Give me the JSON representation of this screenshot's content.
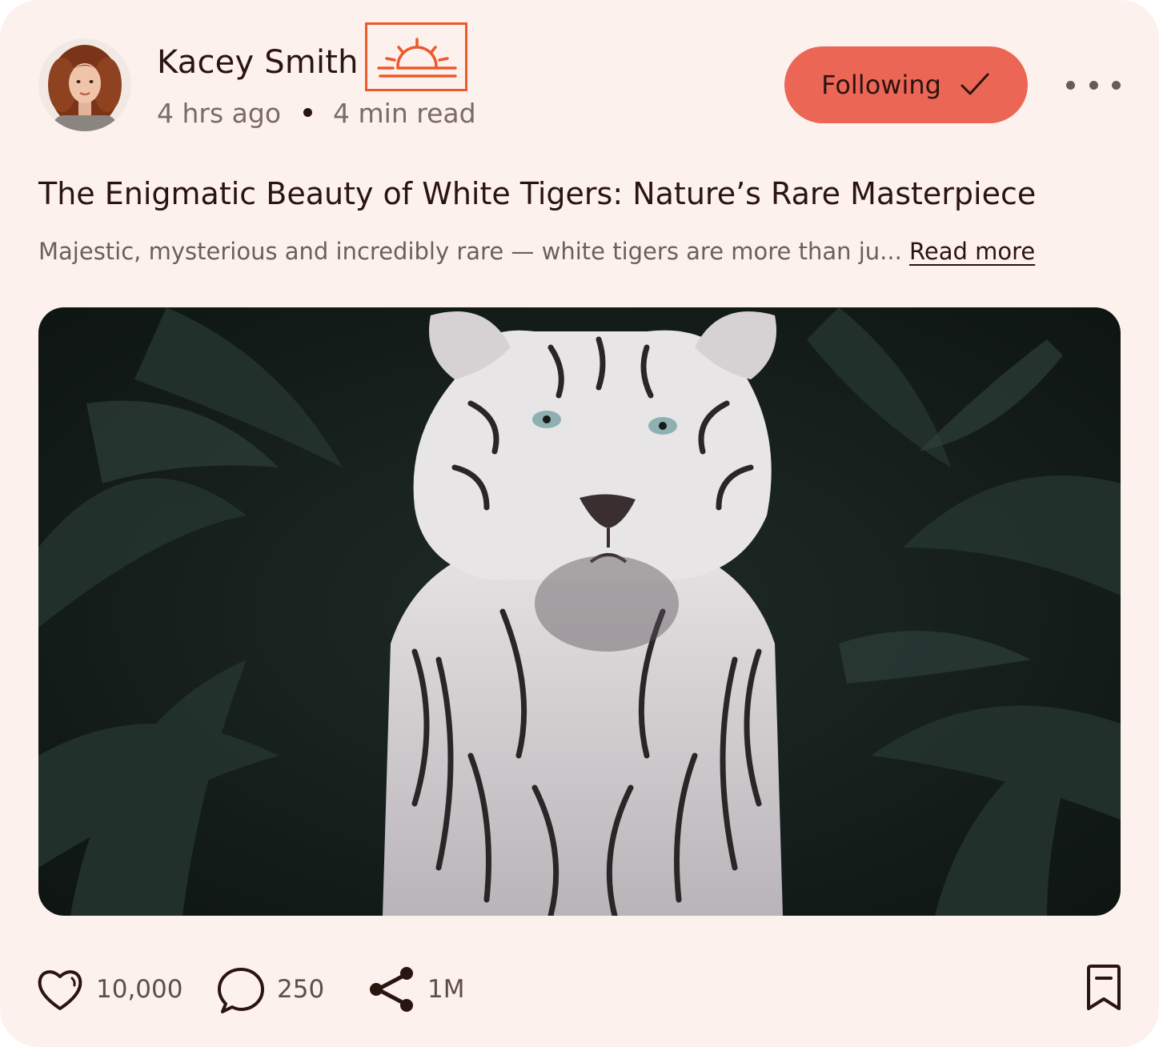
{
  "author": {
    "name": "Kacey Smith",
    "posted": "4 hrs ago",
    "read_time": "4 min read",
    "mood_icon": "sunrise-icon",
    "mood_color": "#ec5a2a"
  },
  "header": {
    "follow_label": "Following",
    "follow_icon": "checkmark-icon",
    "more_icon": "more-horizontal-icon"
  },
  "post": {
    "title": "The Enigmatic Beauty of White Tigers: Nature’s Rare Masterpiece",
    "excerpt": "Majestic, mysterious and incredibly rare — white tigers are more than ju...",
    "read_more": "Read more",
    "image": "white-tiger-photo"
  },
  "stats": {
    "likes": "10,000",
    "comments": "250",
    "shares": "1M"
  },
  "colors": {
    "card_bg": "#fdf1ee",
    "accent": "#ec6656",
    "text": "#2a1410"
  }
}
